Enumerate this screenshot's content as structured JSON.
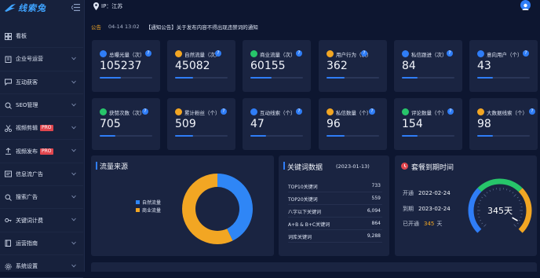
{
  "app": {
    "logo_text": "线索兔"
  },
  "topbar": {
    "location": "IP：江苏"
  },
  "sidebar": {
    "items": [
      {
        "label": "看板",
        "icon": "dashboard-icon",
        "pro": "",
        "chevron": false
      },
      {
        "label": "企业号运营",
        "icon": "building-icon",
        "pro": "",
        "chevron": true
      },
      {
        "label": "互动获客",
        "icon": "chat-icon",
        "pro": "",
        "chevron": true
      },
      {
        "label": "SEO管理",
        "icon": "seo-icon",
        "pro": "",
        "chevron": true
      },
      {
        "label": "视频剪辑",
        "icon": "scissors-icon",
        "pro": "PRO",
        "chevron": true
      },
      {
        "label": "视频发布",
        "icon": "upload-icon",
        "pro": "PRO",
        "chevron": true
      },
      {
        "label": "信息流广告",
        "icon": "feed-icon",
        "pro": "",
        "chevron": true
      },
      {
        "label": "搜索广告",
        "icon": "search-icon",
        "pro": "",
        "chevron": true
      },
      {
        "label": "关键词计费",
        "icon": "key-icon",
        "pro": "",
        "chevron": true
      },
      {
        "label": "运营指南",
        "icon": "book-icon",
        "pro": "",
        "chevron": true
      },
      {
        "label": "系统设置",
        "icon": "gear-icon",
        "pro": "",
        "chevron": true
      }
    ]
  },
  "notice": {
    "label": "公告",
    "date": "04-14 13:02",
    "text": "【通知公告】关于发布内容不得出现违禁词的通知"
  },
  "stats": [
    {
      "title": "总曝光量（次）",
      "value": "105237",
      "icon_color": "#2f7df6"
    },
    {
      "title": "自然流量（次）",
      "value": "45082",
      "icon_color": "#f2a623"
    },
    {
      "title": "商业流量（次）",
      "value": "60155",
      "icon_color": "#27c56a"
    },
    {
      "title": "用户行为（次）",
      "value": "362",
      "icon_color": "#f2a623"
    },
    {
      "title": "私信跟进（次）",
      "value": "84",
      "icon_color": "#2f7df6"
    },
    {
      "title": "意向用户（个）",
      "value": "43",
      "icon_color": "#2f7df6"
    },
    {
      "title": "获赞次数（次）",
      "value": "705",
      "icon_color": "#27c56a"
    },
    {
      "title": "累计粉丝（个）",
      "value": "509",
      "icon_color": "#f2a623"
    },
    {
      "title": "互动线索（个）",
      "value": "47",
      "icon_color": "#2f7df6"
    },
    {
      "title": "私信数量（个）",
      "value": "96",
      "icon_color": "#f2a623"
    },
    {
      "title": "评论数量（个）",
      "value": "154",
      "icon_color": "#27c56a"
    },
    {
      "title": "大数据线索（个）",
      "value": "98",
      "icon_color": "#f2a623"
    }
  ],
  "traffic": {
    "title": "流量来源",
    "legend": [
      "自然流量",
      "商业流量"
    ]
  },
  "chart_data": {
    "type": "pie",
    "labels": [
      "自然流量",
      "商业流量"
    ],
    "values": [
      45082,
      60155
    ],
    "colors": [
      "#2f86f6",
      "#f2a623"
    ],
    "legend_position": "left"
  },
  "keywords": {
    "title": "关键词数据",
    "date": "(2023-01-13)",
    "rows": [
      {
        "label": "TOP10关键词",
        "value": "733"
      },
      {
        "label": "TOP20关键词",
        "value": "559"
      },
      {
        "label": "八字以下关键词",
        "value": "6,094"
      },
      {
        "label": "A+B & B+C关键词",
        "value": "864"
      },
      {
        "label": "词库关键词",
        "value": "9,288"
      }
    ]
  },
  "package": {
    "title": "套餐到期时间",
    "open_label": "开通",
    "open_date": "2022-02-24",
    "expire_label": "到期",
    "expire_date": "2023-02-24",
    "days_label": "已开通",
    "days_value": "345",
    "days_unit": "天",
    "gauge_text": "345天",
    "gauge_fraction": 0.945
  },
  "colors": {
    "accent": "#2f7df6",
    "orange": "#f2a623",
    "green": "#27c56a",
    "red": "#e0464e"
  }
}
